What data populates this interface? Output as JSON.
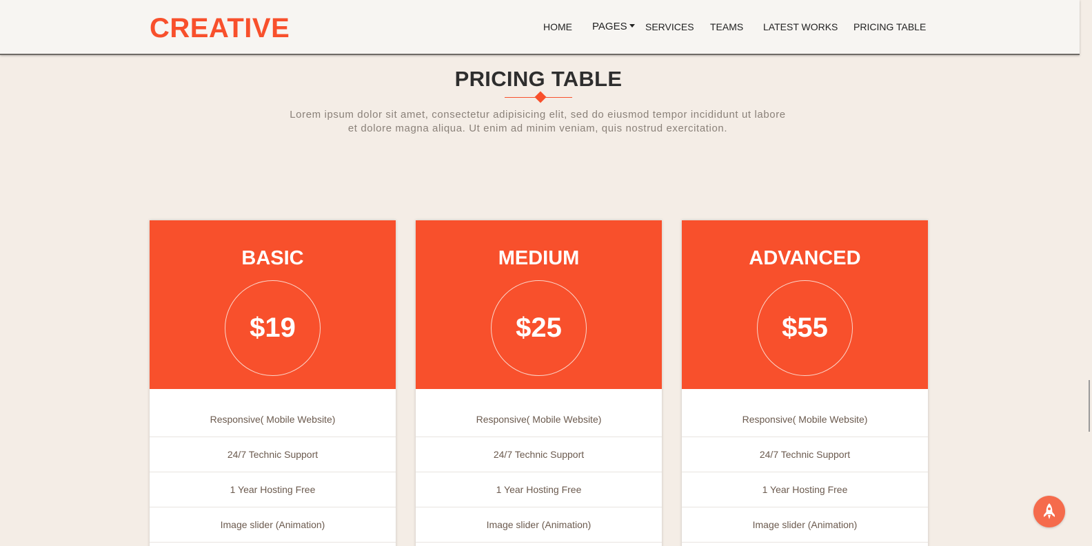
{
  "brand": "CREATIVE",
  "nav": {
    "items": [
      "HOME",
      "PAGES",
      "SERVICES",
      "TEAMS",
      "LATEST WORKS",
      "PRICING TABLE"
    ]
  },
  "section": {
    "title": "PRICING TABLE",
    "intro_line1": "Lorem ipsum dolor sit amet, consectetur adipisicing elit, sed do eiusmod tempor incididunt ut labore",
    "intro_line2": "et dolore magna aliqua. Ut enim ad minim veniam, quis nostrud exercitation."
  },
  "plans": [
    {
      "name": "BASIC",
      "price": "$19",
      "features": [
        "Responsive( Mobile Website)",
        "24/7 Technic Support",
        "1 Year Hosting Free",
        "Image slider (Animation)"
      ]
    },
    {
      "name": "MEDIUM",
      "price": "$25",
      "features": [
        "Responsive( Mobile Website)",
        "24/7 Technic Support",
        "1 Year Hosting Free",
        "Image slider (Animation)"
      ]
    },
    {
      "name": "ADVANCED",
      "price": "$55",
      "features": [
        "Responsive( Mobile Website)",
        "24/7 Technic Support",
        "1 Year Hosting Free",
        "Image slider (Animation)"
      ]
    }
  ],
  "icons": {
    "nav_dropdown": "caret-down-icon",
    "title_ornament": "diamond-icon",
    "back_to_top": "rocket-icon"
  },
  "colors": {
    "accent": "#f8502c",
    "background": "#f4ede6",
    "navbar": "#f7f5f2",
    "card": "#ffffff",
    "feature_text": "#6b5a4e"
  }
}
